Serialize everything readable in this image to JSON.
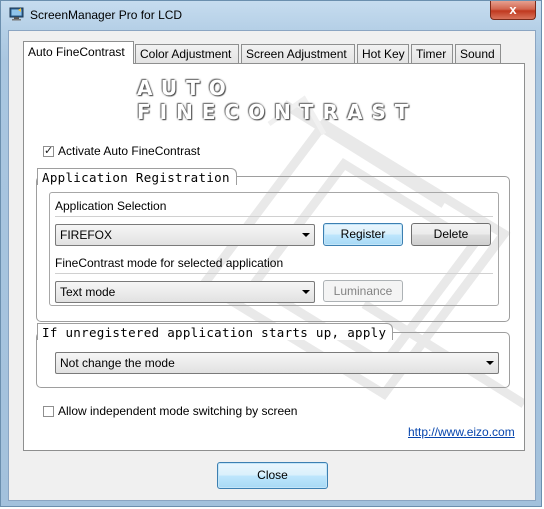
{
  "window": {
    "title": "ScreenManager Pro for LCD",
    "close_glyph": "x"
  },
  "tabs": [
    {
      "label": "Auto FineContrast",
      "active": true
    },
    {
      "label": "Color Adjustment",
      "active": false
    },
    {
      "label": "Screen Adjustment",
      "active": false
    },
    {
      "label": "Hot Key",
      "active": false
    },
    {
      "label": "Timer",
      "active": false
    },
    {
      "label": "Sound",
      "active": false
    }
  ],
  "panel": {
    "banner": "AUTO FINECONTRAST",
    "activate_checkbox": {
      "label": "Activate Auto FineContrast",
      "checked": true
    },
    "app_registration": {
      "title": "Application Registration",
      "selection_label": "Application Selection",
      "app_select_value": "FIREFOX",
      "register_button": "Register",
      "delete_button": "Delete",
      "mode_label": "FineContrast mode for selected application",
      "mode_select_value": "Text mode",
      "luminance_button": "Luminance"
    },
    "unregistered": {
      "title": "If unregistered application starts up, apply",
      "select_value": "Not change the mode"
    },
    "independent_checkbox": {
      "label": "Allow independent mode switching by screen",
      "checked": false
    },
    "link": "http://www.eizo.com"
  },
  "footer": {
    "close_button": "Close"
  },
  "colors": {
    "accent": "#3c7fb1",
    "link": "#0645ad",
    "titlebar": "#b4cfe6",
    "close_red": "#c0391f"
  }
}
